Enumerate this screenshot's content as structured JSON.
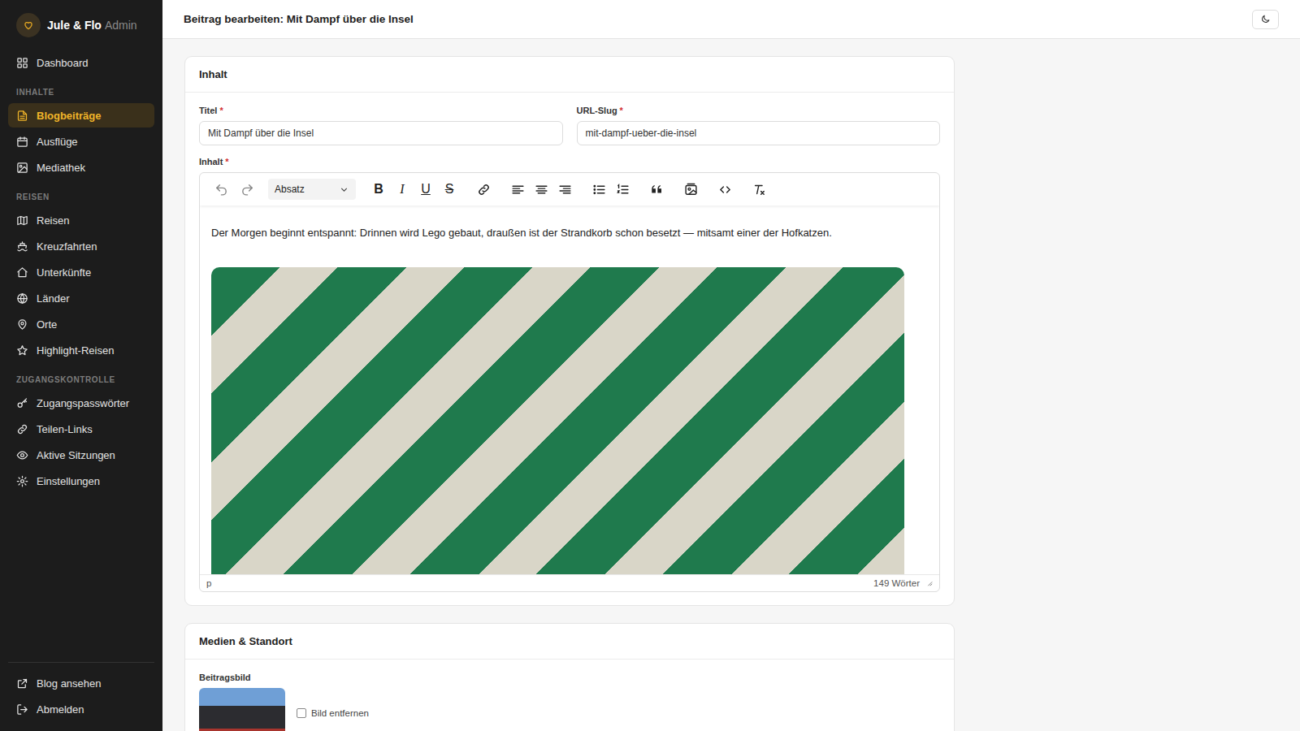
{
  "brand": {
    "name": "Jule & Flo",
    "suffix": "Admin"
  },
  "nav_top": [
    {
      "label": "Dashboard",
      "selected": false
    }
  ],
  "sections": [
    {
      "heading": "INHALTE",
      "items": [
        {
          "label": "Blogbeiträge",
          "selected": true
        },
        {
          "label": "Ausflüge",
          "selected": false
        },
        {
          "label": "Mediathek",
          "selected": false
        }
      ]
    },
    {
      "heading": "REISEN",
      "items": [
        {
          "label": "Reisen",
          "selected": false
        },
        {
          "label": "Kreuzfahrten",
          "selected": false
        },
        {
          "label": "Unterkünfte",
          "selected": false
        },
        {
          "label": "Länder",
          "selected": false
        },
        {
          "label": "Orte",
          "selected": false
        },
        {
          "label": "Highlight-Reisen",
          "selected": false
        }
      ]
    },
    {
      "heading": "ZUGANGSKONTROLLE",
      "items": [
        {
          "label": "Zugangspasswörter",
          "selected": false
        },
        {
          "label": "Teilen-Links",
          "selected": false
        },
        {
          "label": "Aktive Sitzungen",
          "selected": false
        },
        {
          "label": "Einstellungen",
          "selected": false
        }
      ]
    }
  ],
  "nav_footer": [
    {
      "label": "Blog ansehen"
    },
    {
      "label": "Abmelden"
    }
  ],
  "page_title": "Beitrag bearbeiten: Mit Dampf über die Insel",
  "content_card": {
    "title": "Inhalt",
    "required_mark": "*",
    "fields": [
      {
        "label": "Titel",
        "required": true,
        "value": "Mit Dampf über die Insel"
      },
      {
        "label": "URL-Slug",
        "required": true,
        "value": "mit-dampf-ueber-die-insel"
      }
    ],
    "editor": {
      "label": "Inhalt",
      "required": true,
      "format": "Absatz",
      "text_buttons": [
        "B",
        "I",
        "U",
        "S"
      ],
      "paragraph": "Der Morgen beginnt entspannt: Drinnen wird Lego gebaut, draußen ist der Strandkorb schon besetzt — mitsamt einer der Hofkatzen.",
      "path": "p",
      "word_count": "149 Wörter"
    }
  },
  "media_card": {
    "title": "Medien & Standort",
    "image_label": "Beitragsbild",
    "remove_label": "Bild entfernen",
    "remove_checked": false
  }
}
